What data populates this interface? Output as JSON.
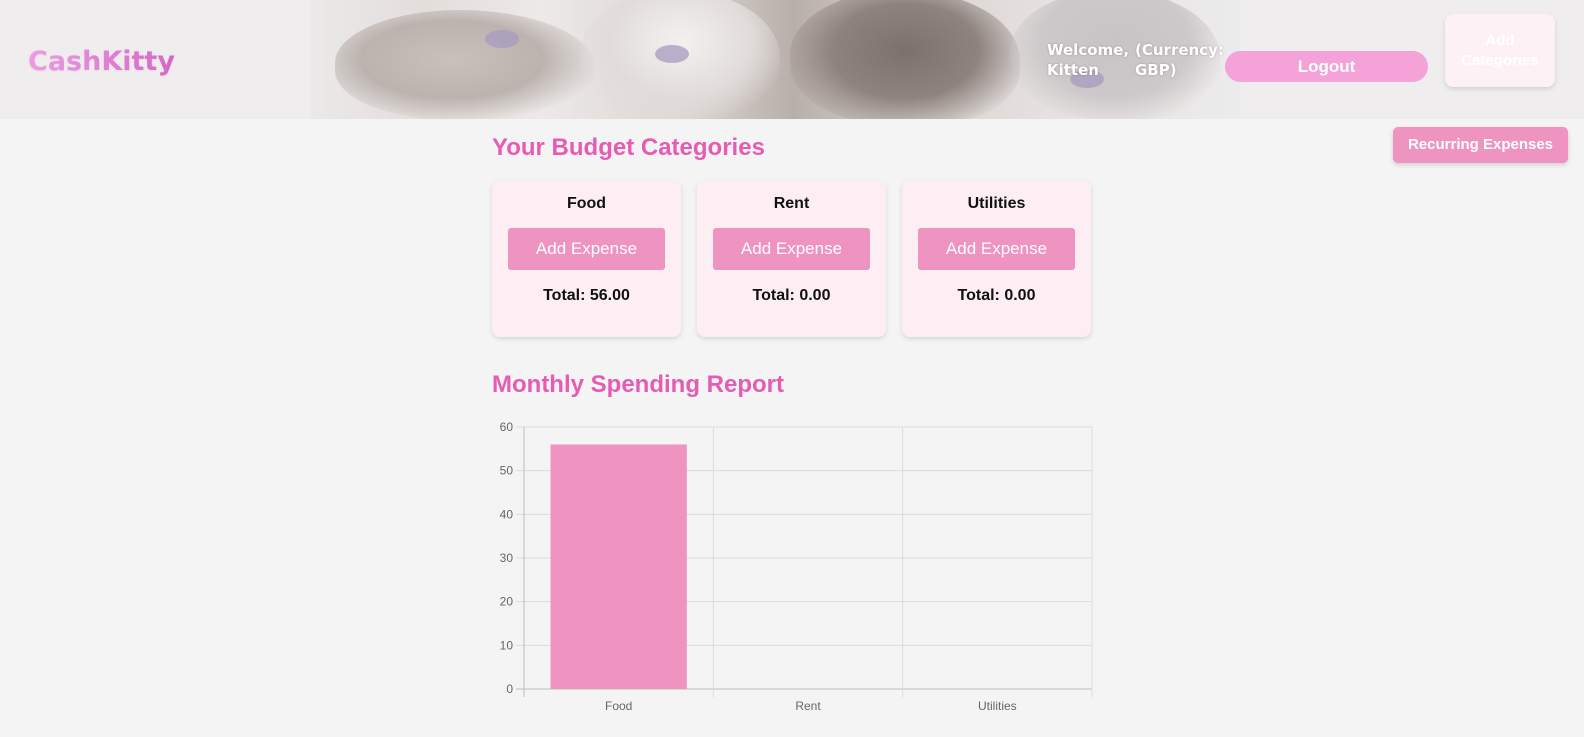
{
  "header": {
    "logo": "CashKitty",
    "welcome": "Welcome, Kitten",
    "currency": "(Currency: GBP)",
    "logout_label": "Logout",
    "add_categories_label": "Add Categories"
  },
  "recurring_label": "Recurring Expenses",
  "budget": {
    "title": "Your Budget Categories",
    "categories": [
      {
        "name": "Food",
        "button": "Add Expense",
        "total": "Total: 56.00"
      },
      {
        "name": "Rent",
        "button": "Add Expense",
        "total": "Total: 0.00"
      },
      {
        "name": "Utilities",
        "button": "Add Expense",
        "total": "Total: 0.00"
      }
    ]
  },
  "report": {
    "title": "Monthly Spending Report"
  },
  "colors": {
    "accent": "#e65bb3",
    "button": "#ef93c1",
    "logout": "#f5a2d8",
    "bar": "#ef93c1"
  },
  "chart_data": {
    "type": "bar",
    "categories": [
      "Food",
      "Rent",
      "Utilities"
    ],
    "values": [
      56,
      0,
      0
    ],
    "title": "",
    "xlabel": "",
    "ylabel": "",
    "ylim": [
      0,
      60
    ],
    "yticks": [
      0,
      10,
      20,
      30,
      40,
      50,
      60
    ],
    "grid": true,
    "legend": "none"
  }
}
